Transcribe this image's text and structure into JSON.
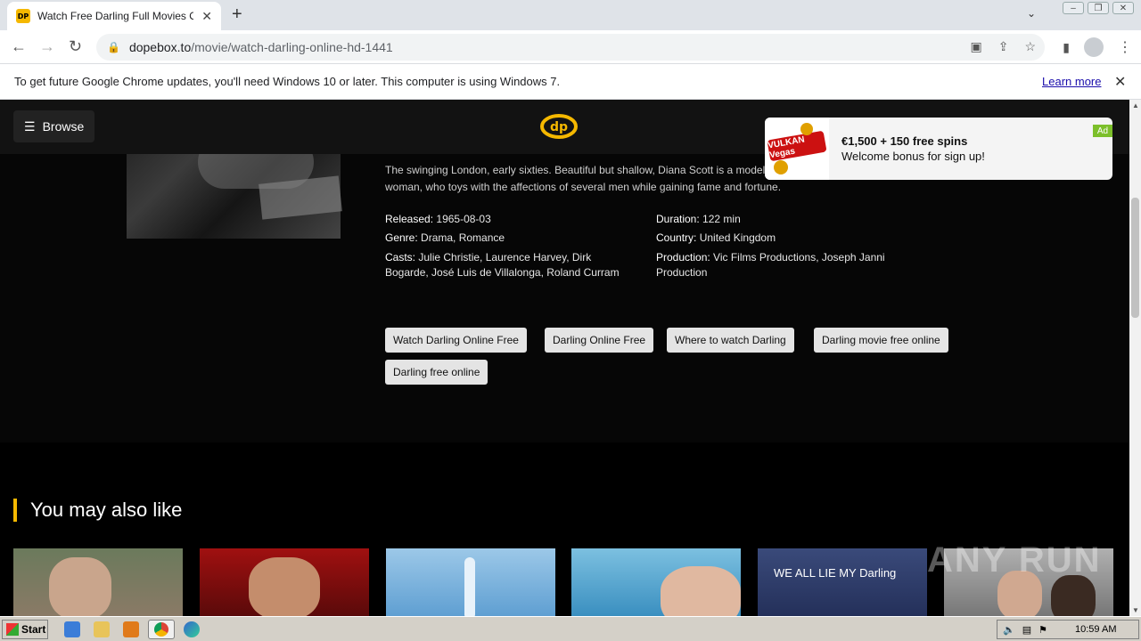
{
  "browser": {
    "tab_title": "Watch Free Darling Full Movies Online",
    "favicon_text": "DP",
    "url_host": "dopebox.to",
    "url_path": "/movie/watch-darling-online-hd-1441",
    "info_text": "To get future Google Chrome updates, you'll need Windows 10 or later. This computer is using Windows 7.",
    "info_link": "Learn more"
  },
  "header": {
    "browse_label": "Browse",
    "logo_text": "dp"
  },
  "ad": {
    "brand": "VULKAN Vegas",
    "title": "€1,500 + 150 free spins",
    "subtitle": "Welcome bonus for sign up!",
    "badge": "Ad"
  },
  "movie": {
    "description": "The swinging London, early sixties. Beautiful but shallow, Diana Scott is a model and sometime actress, a vocationally bored woman, who toys with the affections of several men while gaining fame and fortune.",
    "released_label": "Released:",
    "released": "1965-08-03",
    "genre_label": "Genre:",
    "genre": "Drama, Romance",
    "casts_label": "Casts:",
    "casts": "Julie Christie, Laurence Harvey, Dirk Bogarde, José Luis de Villalonga, Roland Curram",
    "duration_label": "Duration:",
    "duration": "122 min",
    "country_label": "Country:",
    "country": "United Kingdom",
    "production_label": "Production:",
    "production": "Vic Films Productions, Joseph Janni Production"
  },
  "tags": [
    "Watch Darling Online Free",
    "Darling Online Free",
    "Where to watch Darling",
    "Darling movie free online",
    "Darling free online"
  ],
  "related": {
    "title": "You may also like",
    "thumb4_text": "WE ALL LIE MY Darling"
  },
  "watermark": "ANY RUN",
  "taskbar": {
    "start_label": "Start",
    "clock": "10:59 AM"
  },
  "colors": {
    "accent": "#f5b800",
    "page_bg": "#000000",
    "tag_bg": "#e4e4e4"
  }
}
